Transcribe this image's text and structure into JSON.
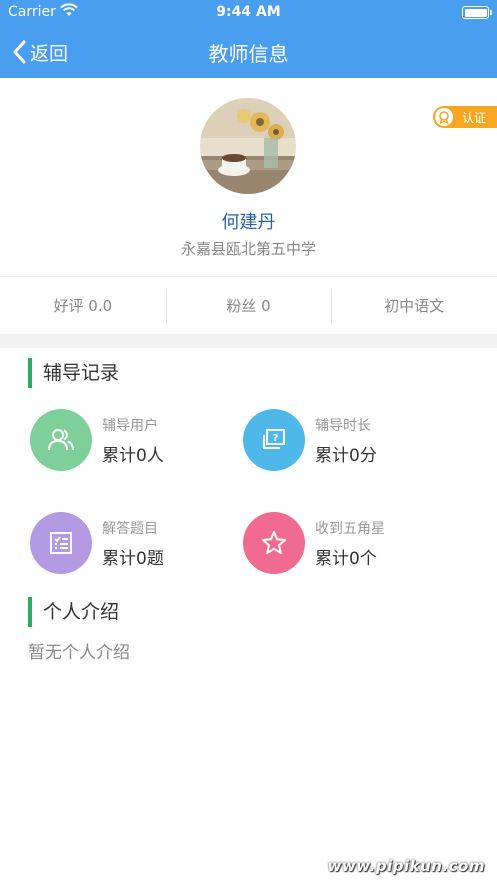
{
  "status_bar": {
    "carrier": "Carrier",
    "time": "9:44 AM"
  },
  "nav": {
    "back_label": "返回",
    "title": "教师信息"
  },
  "badge": {
    "label": "认证",
    "color": "#f5a623"
  },
  "teacher": {
    "name": "何建丹",
    "school": "永嘉县瓯北第五中学"
  },
  "stats": [
    "好评 0.0",
    "粉丝 0",
    "初中语文"
  ],
  "sections": {
    "records_title": "辅导记录",
    "intro_title": "个人介绍"
  },
  "records": [
    {
      "icon": "users-icon",
      "label": "辅导用户",
      "value": "累计0人",
      "color": "#7fcf9b"
    },
    {
      "icon": "question-board-icon",
      "label": "辅导时长",
      "value": "累计0分",
      "color": "#4fb8ea"
    },
    {
      "icon": "checklist-icon",
      "label": "解答题目",
      "value": "累计0题",
      "color": "#b39ae3"
    },
    {
      "icon": "star-icon",
      "label": "收到五角星",
      "value": "累计0个",
      "color": "#f06b8f"
    }
  ],
  "intro": {
    "text": "暂无个人介绍"
  },
  "watermark": "www.pipikun.com"
}
